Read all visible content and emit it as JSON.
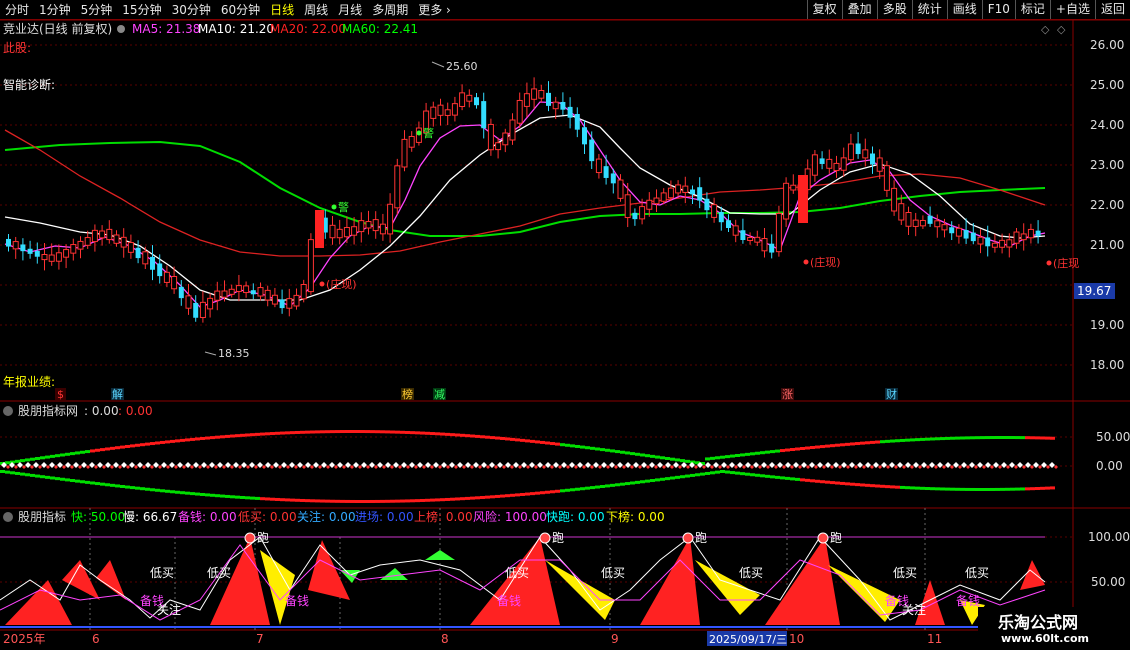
{
  "toolbar": {
    "periods": [
      "分时",
      "1分钟",
      "5分钟",
      "15分钟",
      "30分钟",
      "60分钟",
      "日线",
      "周线",
      "月线",
      "多周期",
      "更多"
    ],
    "active_period": "日线",
    "actions": [
      "复权",
      "叠加",
      "多股",
      "统计",
      "画线",
      "F10",
      "标记",
      "+自选",
      "返回"
    ]
  },
  "main_panel": {
    "stock_title": "竞业达(日线 前复权)",
    "ma_legend": [
      {
        "label": "MA5: 21.38",
        "color": "#ff44ff"
      },
      {
        "label": "MA10: 21.20",
        "color": "#ffffff"
      },
      {
        "label": "MA20: 22.00",
        "color": "#ff2222"
      },
      {
        "label": "MA60: 22.41",
        "color": "#00ff00"
      }
    ],
    "label_cigu": "此股:",
    "label_diagnosis": "智能诊断:",
    "label_annual_report": "年报业绩:",
    "high_marker": "25.60",
    "low_marker": "18.35",
    "current_price_tag": "19.67",
    "alert_marks": [
      "警",
      "警"
    ],
    "zhuangxian_marks": [
      "(庄现)",
      "(庄现)",
      "(庄现"
    ],
    "event_icons": [
      {
        "text": "$",
        "color": "#ff3333"
      },
      {
        "text": "解",
        "color": "#5ad5ff"
      },
      {
        "text": "榜",
        "color": "#ffcc33"
      },
      {
        "text": "减",
        "color": "#33ff66"
      },
      {
        "text": "涨",
        "color": "#ff6666"
      },
      {
        "text": "财",
        "color": "#5ad5ff"
      }
    ],
    "price_axis": [
      "26.00",
      "25.00",
      "24.00",
      "23.00",
      "22.00",
      "21.00",
      "19.00",
      "18.00"
    ]
  },
  "panel_net": {
    "title": "股朋指标网",
    "values": [
      ": 0.00",
      ": 0.00"
    ],
    "axis": [
      "50.00",
      "0.00"
    ]
  },
  "panel_ind": {
    "title": "股朋指标",
    "legend": [
      {
        "label": "快: 50.00",
        "color": "#00ff00"
      },
      {
        "label": "慢: 66.67",
        "color": "#ffffff"
      },
      {
        "label": "备钱: 0.00",
        "color": "#ff44ff"
      },
      {
        "label": "低买: 0.00",
        "color": "#ff3333"
      },
      {
        "label": "关注: 0.00",
        "color": "#33aaff"
      },
      {
        "label": "进场: 0.00",
        "color": "#3355ff"
      },
      {
        "label": "上榜: 0.00",
        "color": "#ff3333"
      },
      {
        "label": "风险: 100.00",
        "color": "#ff44ff"
      },
      {
        "label": "快跑: 0.00",
        "color": "#00ffff"
      },
      {
        "label": "下榜: 0.00",
        "color": "#ffff00"
      }
    ],
    "axis": [
      "100.00",
      "50.00"
    ],
    "run_label": "跑",
    "low_buy_label": "低买",
    "prep_money_label": "备钱",
    "focus_label": "关注"
  },
  "date_axis": {
    "year": "2025年",
    "months": [
      "6",
      "7",
      "8",
      "9",
      "10",
      "11"
    ],
    "cursor_date": "2025/09/17/三"
  },
  "watermark": {
    "line1": "乐淘公式网",
    "line2": "www.60lt.com"
  }
}
